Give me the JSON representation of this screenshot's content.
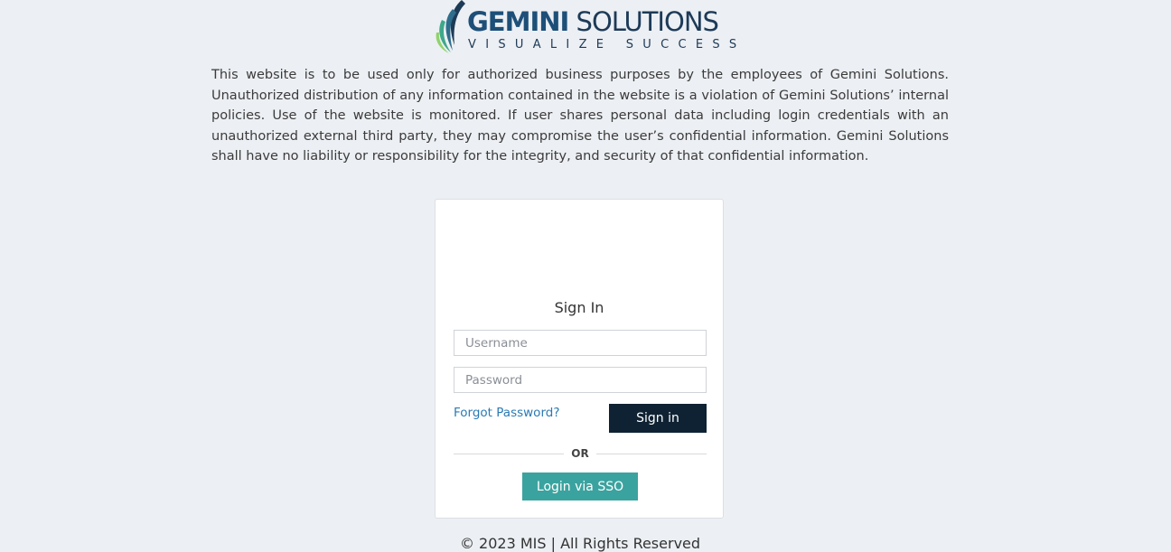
{
  "logo": {
    "brand_bold": "GEMINI",
    "brand_light": " SOLUTIONS",
    "tagline": "VISUALIZE SUCCESS"
  },
  "disclaimer": "This website is to be used only for authorized business purposes by the employees of Gemini Solutions. Unauthorized distribution of any information contained in the website is a violation of Gemini Solutions’ internal policies. Use of the website is monitored. If user shares personal data including login credentials with an unauthorized external third party, they may compromise the user’s confidential information. Gemini Solutions shall have no liability or responsibility for the integrity, and security of that confidential information.",
  "login": {
    "title": "Sign In",
    "username": {
      "value": "",
      "placeholder": "Username"
    },
    "password": {
      "value": "",
      "placeholder": "Password"
    },
    "forgot_label": "Forgot Password?",
    "signin_label": "Sign in",
    "or_label": "OR",
    "sso_label": "Login via SSO"
  },
  "footer": "© 2023 MIS | All Rights Reserved",
  "colors": {
    "background": "#eceff3",
    "brand_navy": "#1d4f78",
    "signin_button": "#0f2233",
    "sso_button": "#3ba39f",
    "link": "#2a7ab5"
  }
}
